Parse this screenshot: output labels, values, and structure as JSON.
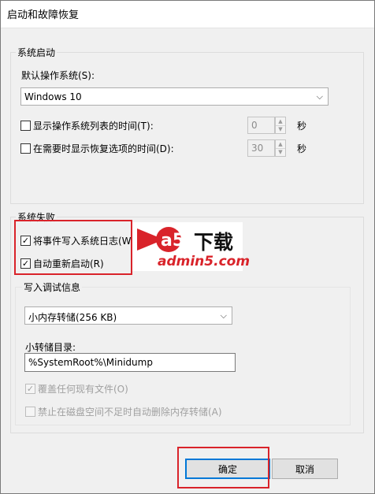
{
  "window": {
    "title": "启动和故障恢复"
  },
  "system_startup": {
    "group_label": "系统启动",
    "default_os_label": "默认操作系统(S):",
    "default_os_value": "Windows 10",
    "show_os_list": {
      "label": "显示操作系统列表的时间(T):",
      "checked": false,
      "value": "0",
      "unit": "秒"
    },
    "show_recovery": {
      "label": "在需要时显示恢复选项的时间(D):",
      "checked": false,
      "value": "30",
      "unit": "秒"
    }
  },
  "system_failure": {
    "group_label": "系统失败",
    "write_event": {
      "label": "将事件写入系统日志(W",
      "checked": true
    },
    "auto_restart": {
      "label": "自动重新启动(R)",
      "checked": true
    },
    "debug_info": {
      "group_label": "写入调试信息",
      "dump_type": "小内存转储(256 KB)",
      "dump_dir_label": "小转储目录:",
      "dump_dir_value": "%SystemRoot%\\Minidump",
      "overwrite": {
        "label": "覆盖任何现有文件(O)",
        "checked": true,
        "disabled": true
      },
      "disable_auto_delete": {
        "label": "禁止在磁盘空间不足时自动删除内存转储(A)",
        "checked": false,
        "disabled": true
      }
    }
  },
  "watermark": {
    "logo_mark": "a5",
    "text": "下载",
    "url": "admin5.com"
  },
  "buttons": {
    "ok": "确定",
    "cancel": "取消"
  },
  "colors": {
    "accent": "#0078d7",
    "highlight": "#d9232a",
    "background": "#f0f0f0"
  }
}
